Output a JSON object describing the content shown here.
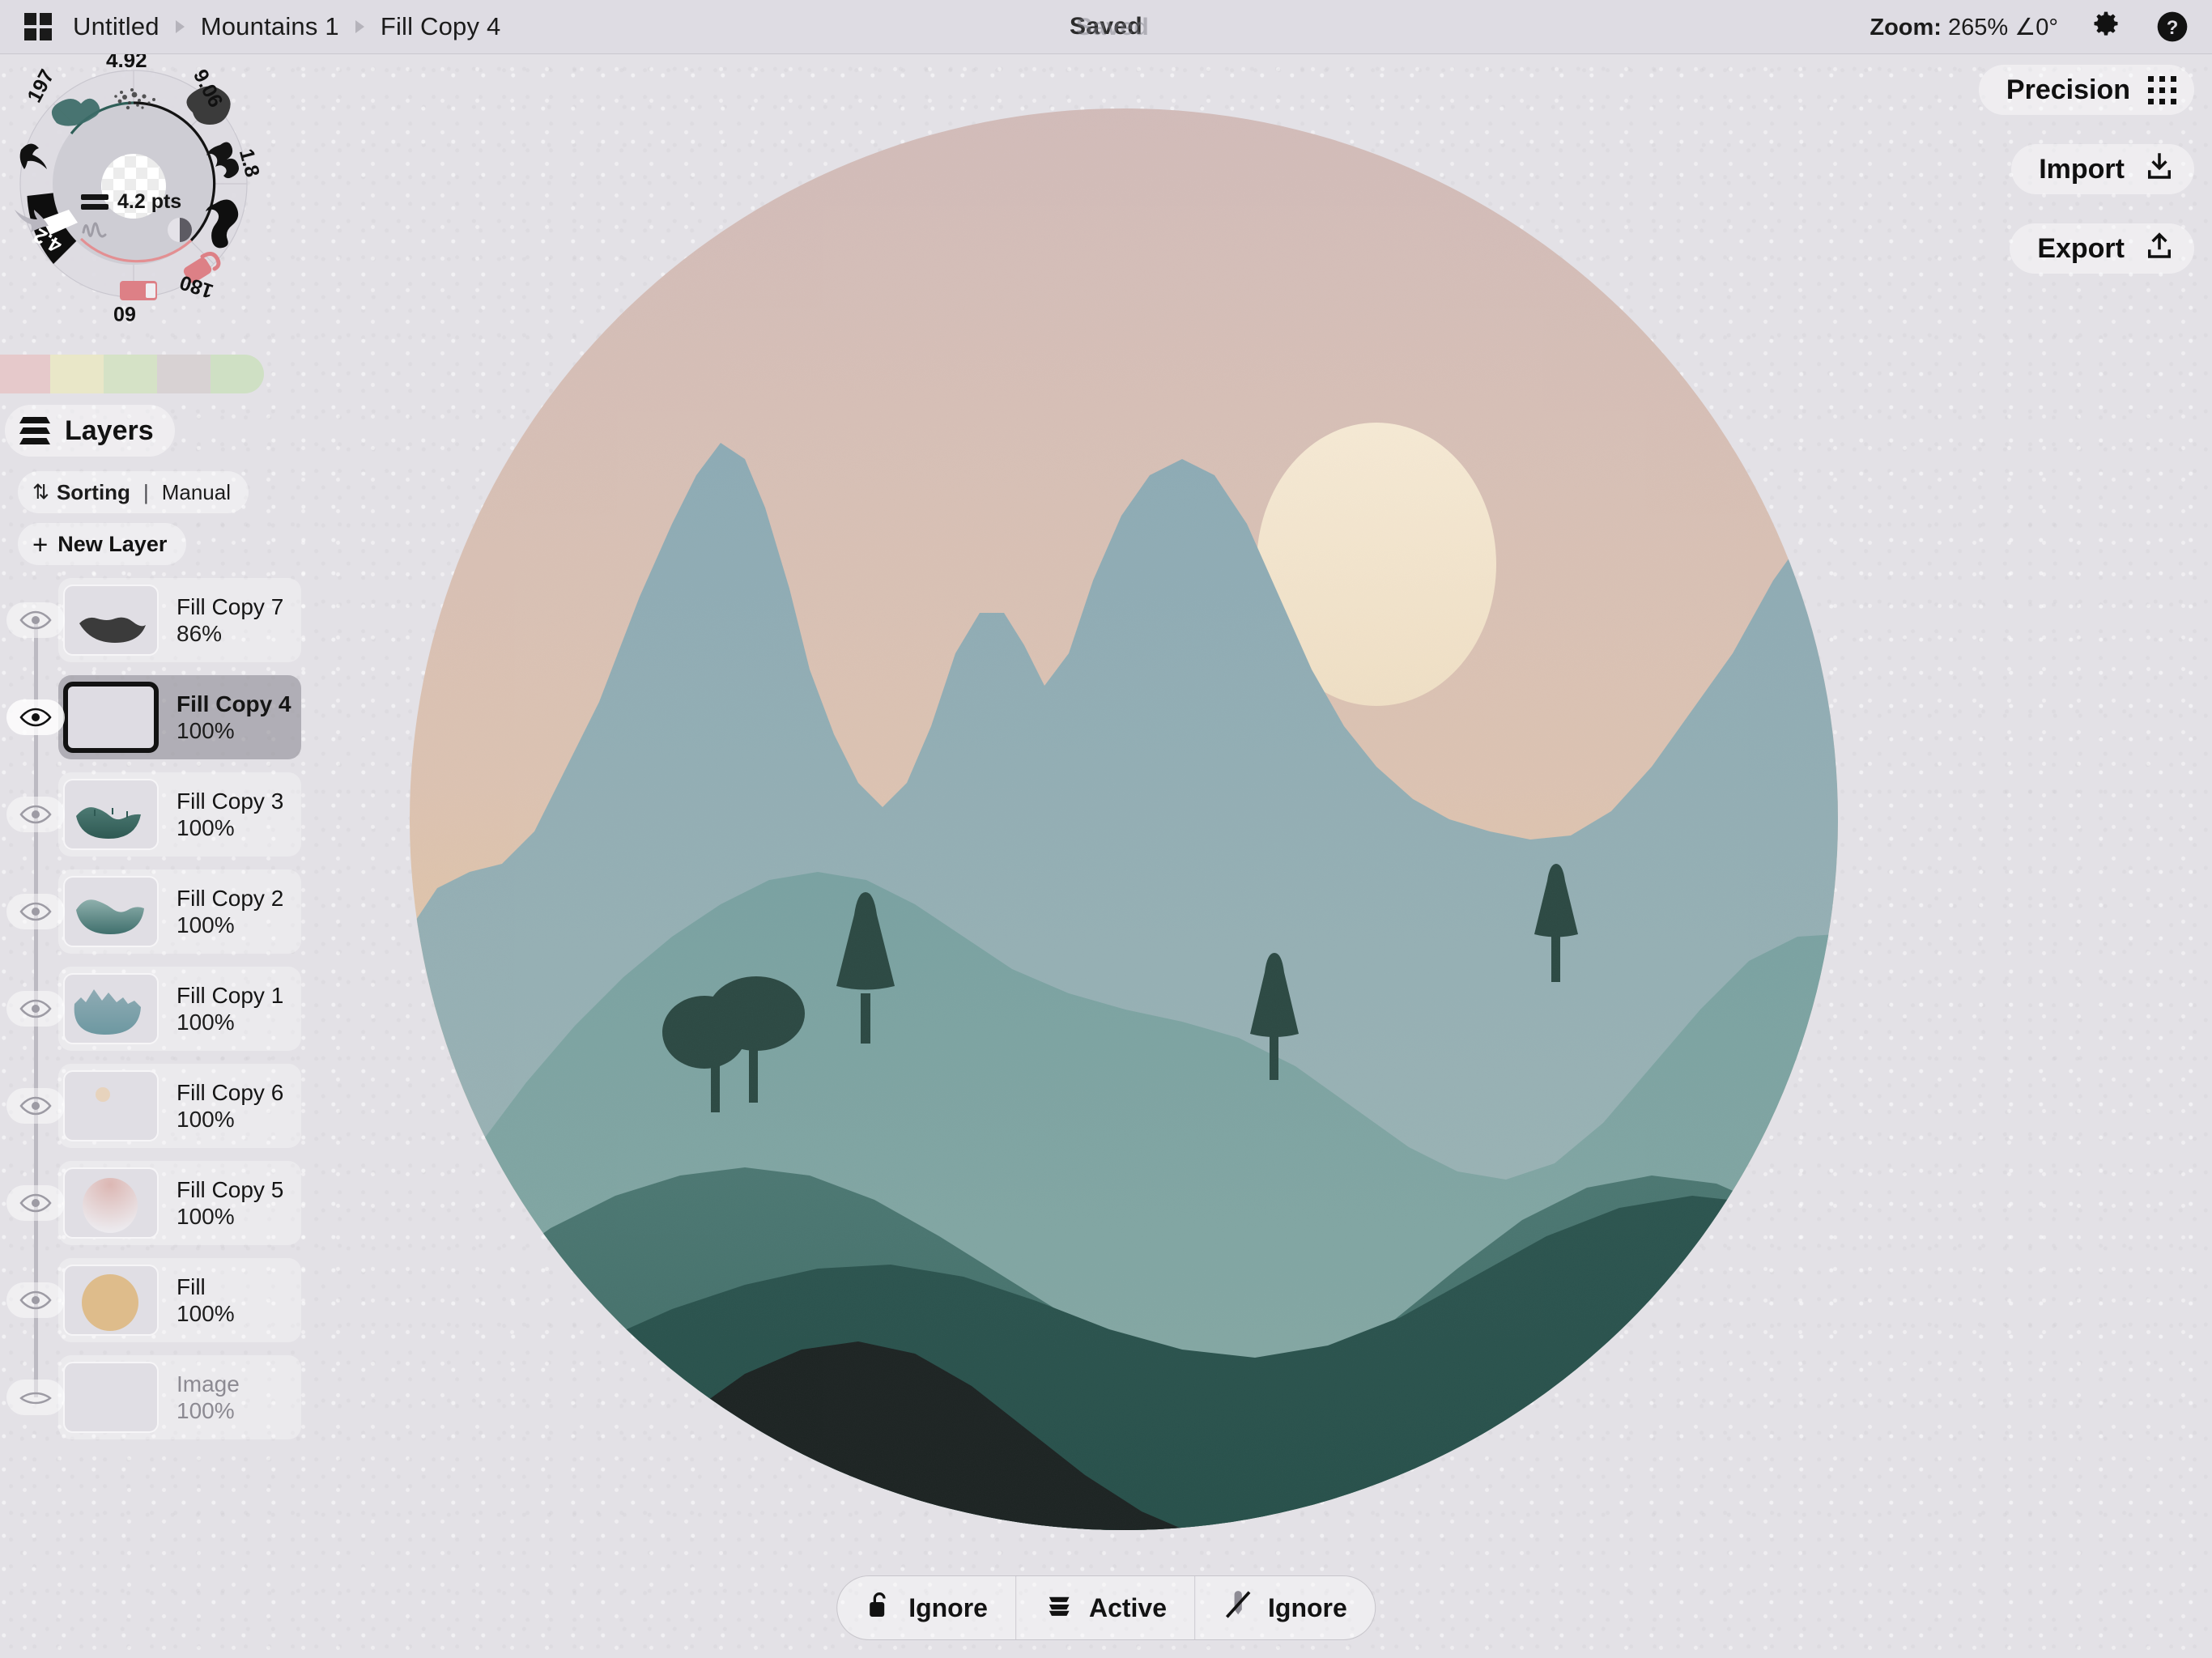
{
  "app": {
    "background_color": "#e3e1e6",
    "topbar_color": "#dedce3"
  },
  "topbar": {
    "grid_icon": "grid-icon",
    "breadcrumb": [
      "Untitled",
      "Mountains 1",
      "Fill Copy 4"
    ],
    "status": "Saved",
    "zoom_label": "Zoom:",
    "zoom_value": "265%",
    "rotation_value": "∠0°",
    "settings_icon": "gear-icon",
    "help_icon": "help-icon"
  },
  "brush_wheel": {
    "center_size": "4.2 pts",
    "segments": [
      {
        "label": "197",
        "icon": "blob-brush-icon"
      },
      {
        "label": "4.92",
        "icon": "scatter-brush-icon"
      },
      {
        "label": "9.06",
        "icon": "charcoal-brush-icon"
      },
      {
        "label": "1.8",
        "icon": "squiggle-brush-icon"
      },
      {
        "label": "",
        "icon": "hook-brush-icon"
      },
      {
        "label": "180",
        "icon": "eraser-icon"
      },
      {
        "label": "60",
        "icon": "opacity-bar-icon"
      },
      {
        "label": "4.2",
        "icon": "size-selector-icon"
      }
    ],
    "undo_icon": "undo-arrow-icon",
    "redo_icon": "redo-arrow-icon",
    "smudge_icon": "smudge-icon",
    "contrast_icon": "contrast-icon",
    "swatch_icon": "transparent-checker-swatch"
  },
  "palette": {
    "swatches": [
      "#e6c9cb",
      "#e9e7c8",
      "#d5e2c6",
      "#d8d2d3",
      "#cfe0c4"
    ]
  },
  "layers_panel": {
    "title": "Layers",
    "layers_icon": "layers-stack-icon",
    "sorting_icon": "sort-arrows-icon",
    "sorting_label": "Sorting",
    "sorting_separator": "|",
    "sorting_value": "Manual",
    "new_layer_plus": "+",
    "new_layer_label": "New Layer",
    "layers": [
      {
        "name": "Fill Copy 7",
        "opacity": "86%",
        "visible": true,
        "selected": false,
        "thumb": "dark-hill-shape"
      },
      {
        "name": "Fill Copy 4",
        "opacity": "100%",
        "visible": true,
        "selected": true,
        "thumb": "empty"
      },
      {
        "name": "Fill Copy 3",
        "opacity": "100%",
        "visible": true,
        "selected": false,
        "thumb": "teal-hill-trees"
      },
      {
        "name": "Fill Copy 2",
        "opacity": "100%",
        "visible": true,
        "selected": false,
        "thumb": "teal-wave"
      },
      {
        "name": "Fill Copy 1",
        "opacity": "100%",
        "visible": true,
        "selected": false,
        "thumb": "blue-mountain"
      },
      {
        "name": "Fill Copy 6",
        "opacity": "100%",
        "visible": true,
        "selected": false,
        "thumb": "small-sun-dot"
      },
      {
        "name": "Fill Copy 5",
        "opacity": "100%",
        "visible": true,
        "selected": false,
        "thumb": "pink-gradient-circle"
      },
      {
        "name": "Fill",
        "opacity": "100%",
        "visible": true,
        "selected": false,
        "thumb": "tan-circle"
      },
      {
        "name": "Image",
        "opacity": "100%",
        "visible": false,
        "selected": false,
        "thumb": "empty"
      }
    ]
  },
  "right_buttons": [
    {
      "label": "Precision",
      "icon": "nine-dots-icon"
    },
    {
      "label": "Import",
      "icon": "import-download-icon"
    },
    {
      "label": "Export",
      "icon": "export-upload-icon"
    }
  ],
  "bottom_bar": [
    {
      "icon": "unlocked-padlock-icon",
      "label": "Ignore"
    },
    {
      "icon": "layers-stack-icon",
      "label": "Active"
    },
    {
      "icon": "pencil-slash-icon",
      "label": "Ignore"
    }
  ],
  "artwork": {
    "title": "Mountains 1",
    "shape": "ellipse",
    "colors": {
      "sky_top": "#d2bdbb",
      "sky_bottom": "#e6c89b",
      "sun": "#f1e3cb",
      "mountain_far": "#8fabb4",
      "mountain_mid": "#7ea09f",
      "hill_near": "#4e7672",
      "hill_dark": "#2d524c",
      "foreground": "#1e2524",
      "tree": "#2d4a44"
    }
  }
}
